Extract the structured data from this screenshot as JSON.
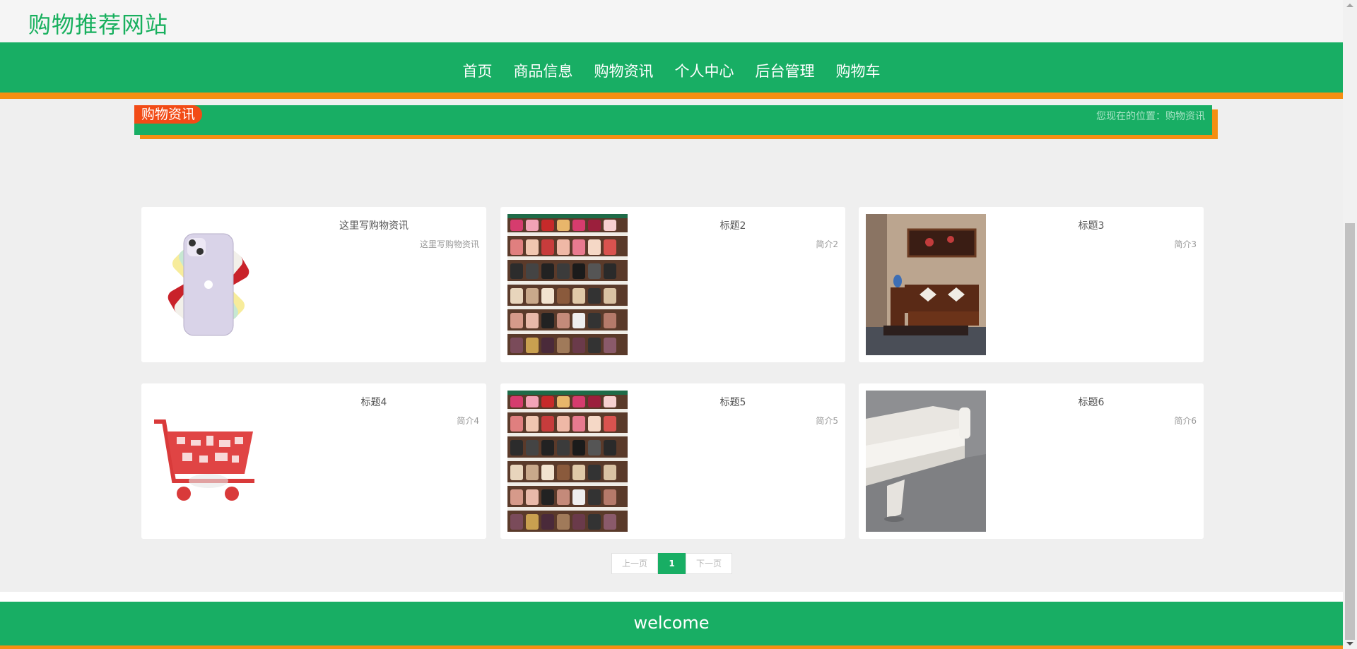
{
  "header": {
    "site_title": "购物推荐网站"
  },
  "nav": {
    "items": [
      "首页",
      "商品信息",
      "购物资讯",
      "个人中心",
      "后台管理",
      "购物车"
    ]
  },
  "section": {
    "tag": "购物资讯",
    "breadcrumb": "您现在的位置：购物资讯"
  },
  "news": [
    {
      "title": "这里写购物资讯",
      "desc": "这里写购物资讯",
      "icon": "iphone-image"
    },
    {
      "title": "标题2",
      "desc": "简介2",
      "icon": "shoe-shelf-image"
    },
    {
      "title": "标题3",
      "desc": "简介3",
      "icon": "living-room-image"
    },
    {
      "title": "标题4",
      "desc": "简介4",
      "icon": "shopping-cart-image"
    },
    {
      "title": "标题5",
      "desc": "简介5",
      "icon": "shoe-shelf-image"
    },
    {
      "title": "标题6",
      "desc": "简介6",
      "icon": "sofa-image"
    }
  ],
  "pager": {
    "prev": "上一页",
    "current": "1",
    "next": "下一页"
  },
  "footer": {
    "text": "welcome"
  },
  "colors": {
    "primary": "#18ae64",
    "accent": "#f58f12",
    "tag": "#f24b16"
  }
}
